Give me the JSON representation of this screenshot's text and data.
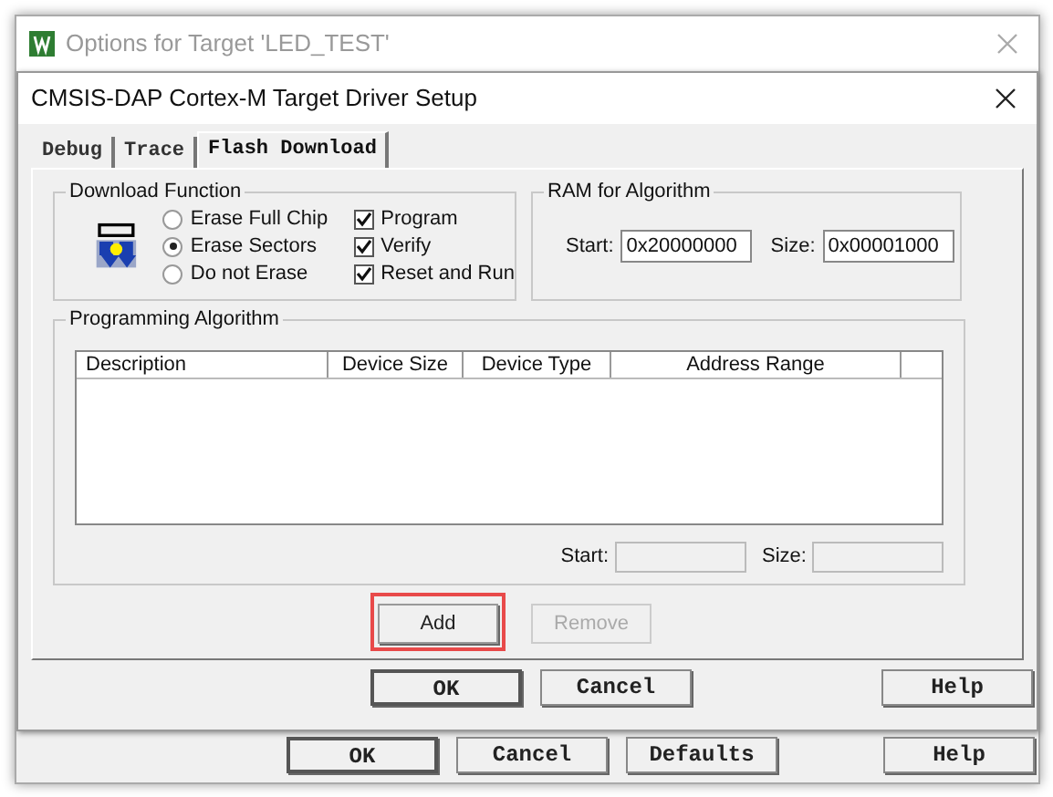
{
  "outer_window": {
    "title": "Options for Target 'LED_TEST'",
    "buttons": [
      {
        "label": "OK",
        "kind": "default"
      },
      {
        "label": "Cancel",
        "kind": "normal"
      },
      {
        "label": "Defaults",
        "kind": "normal"
      },
      {
        "label": "Help",
        "kind": "help"
      }
    ]
  },
  "dialog": {
    "title": "CMSIS-DAP Cortex-M Target Driver Setup",
    "tabs": [
      {
        "label": "Debug",
        "selected": false
      },
      {
        "label": "Trace",
        "selected": false
      },
      {
        "label": "Flash Download",
        "selected": true
      }
    ],
    "download_function": {
      "title": "Download Function",
      "erase_options": [
        {
          "label": "Erase Full Chip",
          "selected": false
        },
        {
          "label": "Erase Sectors",
          "selected": true
        },
        {
          "label": "Do not Erase",
          "selected": false
        }
      ],
      "checks": [
        {
          "label": "Program",
          "checked": true
        },
        {
          "label": "Verify",
          "checked": true
        },
        {
          "label": "Reset and Run",
          "checked": true
        }
      ]
    },
    "ram": {
      "title": "RAM for Algorithm",
      "start_label": "Start:",
      "start": "0x20000000",
      "size_label": "Size:",
      "size": "0x00001000"
    },
    "programming_algorithm": {
      "title": "Programming Algorithm",
      "columns": [
        "Description",
        "Device Size",
        "Device Type",
        "Address Range"
      ],
      "start_label": "Start:",
      "size_label": "Size:"
    },
    "actions": [
      {
        "label": "Add",
        "disabled": false,
        "highlighted": true
      },
      {
        "label": "Remove",
        "disabled": true,
        "highlighted": false
      }
    ],
    "buttons": [
      {
        "label": "OK",
        "kind": "default"
      },
      {
        "label": "Cancel",
        "kind": "normal"
      },
      {
        "label": "Help",
        "kind": "help"
      }
    ]
  }
}
